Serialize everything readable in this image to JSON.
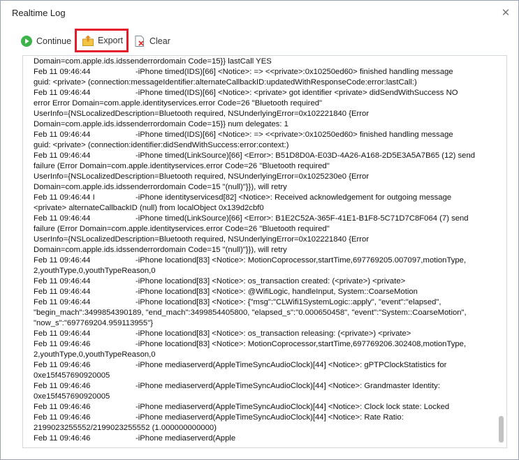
{
  "window": {
    "title": "Realtime Log",
    "close_glyph": "✕"
  },
  "toolbar": {
    "continue_label": "Continue",
    "export_label": "Export",
    "clear_label": "Clear",
    "continue_icon": "play-circle-icon",
    "export_icon": "export-box-icon",
    "clear_icon": "clear-document-icon",
    "export_highlight_color": "#e21c2b",
    "continue_icon_color": "#3cb44b"
  },
  "log": {
    "lines": [
      {
        "ts": "",
        "text": "Domain=com.apple.ids.idssenderrordomain Code=15}} lastCall YES"
      },
      {
        "ts": "Feb 11 09:46:44",
        "text": "-iPhone timed(IDS)[66] <Notice>: => <<private>:0x10250ed60> finished handling message"
      },
      {
        "ts": "",
        "text": "guid: <private> (connection:messageIdentifier:alternateCallbackID:updatedWithResponseCode:error:lastCall:)"
      },
      {
        "ts": "Feb 11 09:46:44",
        "text": "-iPhone timed(IDS)[66] <Notice>: <private> got identifier <private> didSendWithSuccess NO"
      },
      {
        "ts": "",
        "text": "error Error Domain=com.apple.identityservices.error Code=26 \"Bluetooth required\""
      },
      {
        "ts": "",
        "text": "UserInfo={NSLocalizedDescription=Bluetooth required, NSUnderlyingError=0x102221840 {Error"
      },
      {
        "ts": "",
        "text": "Domain=com.apple.ids.idssenderrordomain Code=15}} num delegates: 1"
      },
      {
        "ts": "Feb 11 09:46:44",
        "text": "-iPhone timed(IDS)[66] <Notice>: => <<private>:0x10250ed60> finished handling message"
      },
      {
        "ts": "",
        "text": "guid: <private> (connection:identifier:didSendWithSuccess:error:context:)"
      },
      {
        "ts": "Feb 11 09:46:44",
        "text": "-iPhone timed(LinkSource)[66] <Error>: B51D8D0A-E03D-4A26-A168-2D5E3A5A7B65 (12) send"
      },
      {
        "ts": "",
        "text": "failure (Error Domain=com.apple.identityservices.error Code=26 \"Bluetooth required\""
      },
      {
        "ts": "",
        "text": "UserInfo={NSLocalizedDescription=Bluetooth required, NSUnderlyingError=0x1025230e0 {Error"
      },
      {
        "ts": "",
        "text": "Domain=com.apple.ids.idssenderrordomain Code=15 \"(null)\"}}), will retry"
      },
      {
        "ts": "Feb 11 09:46:44 I",
        "text": "-iPhone identityservicesd[82] <Notice>: Received acknowledgement for outgoing message"
      },
      {
        "ts": "",
        "text": "<private> alternateCallbackID (null) from localObject 0x139d2cbf0"
      },
      {
        "ts": "Feb 11 09:46:44",
        "text": "-iPhone timed(LinkSource)[66] <Error>: B1E2C52A-365F-41E1-B1F8-5C71D7C8F064 (7) send"
      },
      {
        "ts": "",
        "text": "failure (Error Domain=com.apple.identityservices.error Code=26 \"Bluetooth required\""
      },
      {
        "ts": "",
        "text": "UserInfo={NSLocalizedDescription=Bluetooth required, NSUnderlyingError=0x102221840 {Error"
      },
      {
        "ts": "",
        "text": "Domain=com.apple.ids.idssenderrordomain Code=15 \"(null)\"}}), will retry"
      },
      {
        "ts": "Feb 11 09:46:44",
        "text": "-iPhone locationd[83] <Notice>: MotionCoprocessor,startTime,697769205.007097,motionType,"
      },
      {
        "ts": "",
        "text": "2,youthType,0,youthTypeReason,0"
      },
      {
        "ts": "Feb 11 09:46:44",
        "text": "-iPhone locationd[83] <Notice>: os_transaction created: (<private>) <private>"
      },
      {
        "ts": "Feb 11 09:46:44",
        "text": "-iPhone locationd[83] <Notice>: @WifiLogic, handleInput, System::CoarseMotion"
      },
      {
        "ts": "Feb 11 09:46:44",
        "text": "-iPhone locationd[83] <Notice>: {\"msg\":\"CLWifi1SystemLogic::apply\", \"event\":\"elapsed\","
      },
      {
        "ts": "",
        "text": "\"begin_mach\":3499854390189, \"end_mach\":3499854405800, \"elapsed_s\":\"0.000650458\", \"event\":\"System::CoarseMotion\","
      },
      {
        "ts": "",
        "text": "\"now_s\":\"697769204.959113955\"}"
      },
      {
        "ts": "Feb 11 09:46:44",
        "text": "-iPhone locationd[83] <Notice>: os_transaction releasing: (<private>) <private>"
      },
      {
        "ts": "Feb 11 09:46:46",
        "text": "-iPhone locationd[83] <Notice>: MotionCoprocessor,startTime,697769206.302408,motionType,"
      },
      {
        "ts": "",
        "text": "2,youthType,0,youthTypeReason,0"
      },
      {
        "ts": "Feb 11 09:46:46",
        "text": "-iPhone mediaserverd(AppleTimeSyncAudioClock)[44] <Notice>: gPTPClockStatistics for"
      },
      {
        "ts": "",
        "text": "0xe15f457690920005"
      },
      {
        "ts": "Feb 11 09:46:46",
        "text": "-iPhone mediaserverd(AppleTimeSyncAudioClock)[44] <Notice>: Grandmaster Identity:"
      },
      {
        "ts": "",
        "text": "0xe15f457690920005"
      },
      {
        "ts": "Feb 11 09:46:46",
        "text": "-iPhone mediaserverd(AppleTimeSyncAudioClock)[44] <Notice>: Clock lock state: Locked"
      },
      {
        "ts": "Feb 11 09:46:46",
        "text": "-iPhone mediaserverd(AppleTimeSyncAudioClock)[44] <Notice>: Rate Ratio:"
      },
      {
        "ts": "",
        "text": "2199023255552/2199023255552 (1.000000000000)"
      },
      {
        "ts": "Feb 11 09:46:46",
        "text": "-iPhone mediaserverd(Apple"
      }
    ]
  }
}
